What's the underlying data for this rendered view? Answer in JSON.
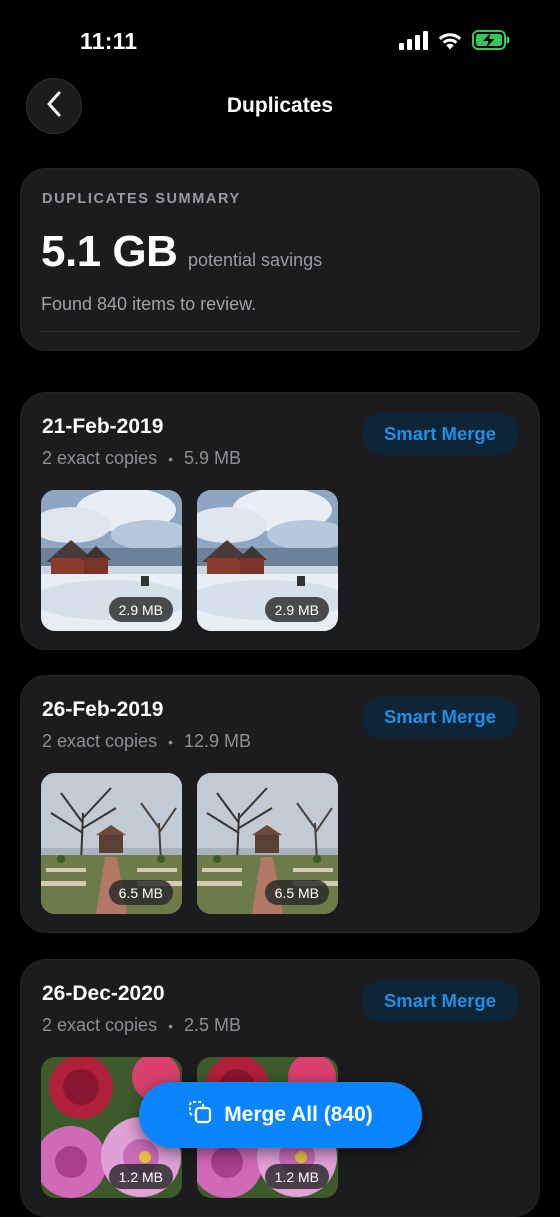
{
  "status_bar": {
    "time": "11:11",
    "icons": [
      "cellular-signal-icon",
      "wifi-icon",
      "battery-charging-icon"
    ]
  },
  "nav": {
    "back_icon": "chevron-left-icon",
    "title": "Duplicates"
  },
  "summary": {
    "heading": "DUPLICATES SUMMARY",
    "size": "5.1 GB",
    "savings_label": "potential savings",
    "found_text": "Found 840 items to review."
  },
  "groups": [
    {
      "date": "21-Feb-2019",
      "copies": "2 exact copies",
      "separator": "•",
      "total_size": "5.9 MB",
      "merge_label": "Smart Merge",
      "thumbs": [
        {
          "size": "2.9 MB"
        },
        {
          "size": "2.9 MB"
        }
      ]
    },
    {
      "date": "26-Feb-2019",
      "copies": "2 exact copies",
      "separator": "•",
      "total_size": "12.9 MB",
      "merge_label": "Smart Merge",
      "thumbs": [
        {
          "size": "6.5 MB"
        },
        {
          "size": "6.5 MB"
        }
      ]
    },
    {
      "date": "26-Dec-2020",
      "copies": "2 exact copies",
      "separator": "•",
      "total_size": "2.5 MB",
      "merge_label": "Smart Merge",
      "thumbs": [
        {
          "size": "1.2 MB"
        },
        {
          "size": "1.2 MB"
        }
      ]
    }
  ],
  "merge_all": {
    "icon": "copy-icon",
    "label": "Merge All (840)"
  },
  "colors": {
    "background": "#000000",
    "card": "#1c1c1e",
    "accent": "#0a84ff",
    "smart_merge_text": "#1e8fe6",
    "battery_green": "#34c759"
  }
}
